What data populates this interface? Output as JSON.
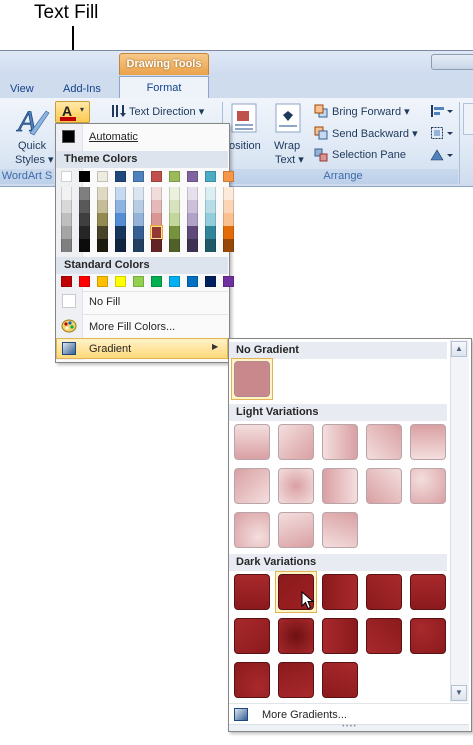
{
  "callout": {
    "label": "Text Fill"
  },
  "ribbon": {
    "contextual_tab": "Drawing Tools",
    "tabs": [
      "View",
      "Add-Ins",
      "Format"
    ],
    "quick_styles_label_1": "Quick",
    "quick_styles_label_2": "Styles",
    "wordart_group_label": "WordArt S",
    "text_direction": "Text Direction",
    "position_label": "osition",
    "wrap_text_1": "Wrap",
    "wrap_text_2": "Text",
    "bring_forward": "Bring Forward",
    "send_backward": "Send Backward",
    "selection_pane": "Selection Pane",
    "arrange_group_label": "Arrange"
  },
  "text_fill_menu": {
    "automatic": "Automatic",
    "theme_colors_header": "Theme Colors",
    "standard_colors_header": "Standard Colors",
    "no_fill": "No Fill",
    "more_fill_colors": "More Fill Colors...",
    "gradient": "Gradient",
    "theme_top_row": [
      "#ffffff",
      "#000000",
      "#eeece1",
      "#1f497d",
      "#4f81bd",
      "#c0504d",
      "#9bbb59",
      "#8064a2",
      "#4bacc6",
      "#f79646"
    ],
    "theme_shades": [
      [
        "#f2f2f2",
        "#7f7f7f",
        "#ddd9c3",
        "#c6d9f0",
        "#dbe5f1",
        "#f2dcdb",
        "#ebf1dd",
        "#e5e0ec",
        "#dbeef3",
        "#fdeada"
      ],
      [
        "#d8d8d8",
        "#595959",
        "#c4bd97",
        "#8db3e2",
        "#b8cce4",
        "#e5b9b7",
        "#d7e3bc",
        "#ccc1d9",
        "#b7dde8",
        "#fbd5b5"
      ],
      [
        "#bfbfbf",
        "#3f3f3f",
        "#938953",
        "#548dd4",
        "#95b3d7",
        "#d99694",
        "#c3d69b",
        "#b2a2c7",
        "#92cddc",
        "#fac08f"
      ],
      [
        "#a5a5a5",
        "#262626",
        "#494429",
        "#17365d",
        "#366092",
        "#953734",
        "#76923c",
        "#5f497a",
        "#31859b",
        "#e36c09"
      ],
      [
        "#7f7f7f",
        "#0c0c0c",
        "#1d1b10",
        "#0f243e",
        "#244061",
        "#632423",
        "#4f6128",
        "#3f3151",
        "#205867",
        "#974806"
      ]
    ],
    "selected_theme_color": "#953734",
    "standard_colors": [
      "#c00000",
      "#ff0000",
      "#ffc000",
      "#ffff00",
      "#92d050",
      "#00b050",
      "#00b0f0",
      "#0070c0",
      "#002060",
      "#7030a0"
    ]
  },
  "gradient_gallery": {
    "no_gradient_header": "No Gradient",
    "light_variations_header": "Light Variations",
    "dark_variations_header": "Dark Variations",
    "more_gradients": "More Gradients...",
    "base_color": "#c0504d",
    "light_color": "#d9a0a3",
    "dark_color": "#8b1a1c"
  }
}
